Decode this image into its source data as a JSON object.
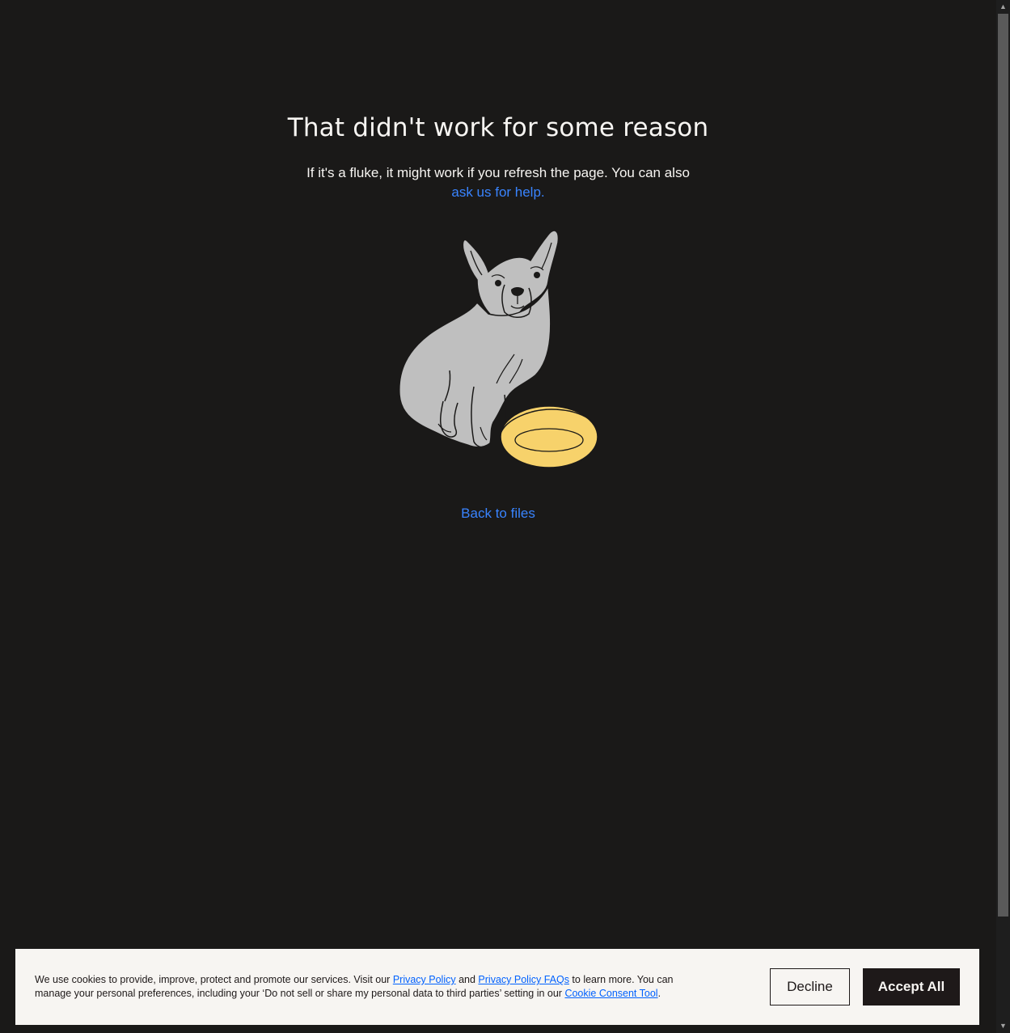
{
  "error": {
    "title": "That didn't work for some reason",
    "message": "If it's a fluke, it might work if you refresh the page. You can also",
    "help_link": "ask us for help.",
    "back_link": "Back to files",
    "illustration": "sad-dog-empty-bowl-icon"
  },
  "cookie_banner": {
    "text_1": "We use cookies to provide, improve, protect and promote our services. Visit our ",
    "privacy_policy": "Privacy Policy",
    "text_2": " and ",
    "privacy_faqs": "Privacy Policy FAQs",
    "text_3": " to learn more. You can manage your personal preferences, including your ‘Do not sell or share my personal data to third parties’ setting in our ",
    "consent_tool": "Cookie Consent Tool",
    "text_4": ".",
    "decline_label": "Decline",
    "accept_label": "Accept All"
  },
  "colors": {
    "background": "#1a1918",
    "link": "#3984ff",
    "bowl": "#f7d26b",
    "dog": "#bfbfbf"
  }
}
